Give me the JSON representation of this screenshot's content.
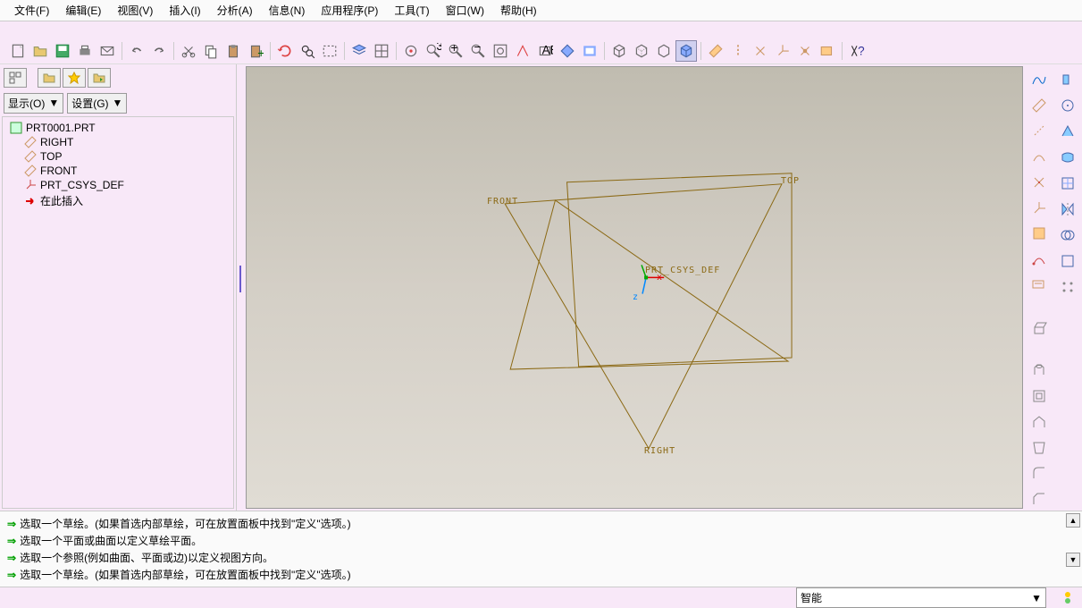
{
  "menubar": {
    "items": [
      "文件(F)",
      "编辑(E)",
      "视图(V)",
      "插入(I)",
      "分析(A)",
      "信息(N)",
      "应用程序(P)",
      "工具(T)",
      "窗口(W)",
      "帮助(H)"
    ]
  },
  "panel": {
    "show_label": "显示(O)",
    "settings_label": "设置(G)"
  },
  "tree": {
    "root": "PRT0001.PRT",
    "items": [
      {
        "label": "RIGHT",
        "type": "plane"
      },
      {
        "label": "TOP",
        "type": "plane"
      },
      {
        "label": "FRONT",
        "type": "plane"
      },
      {
        "label": "PRT_CSYS_DEF",
        "type": "csys"
      },
      {
        "label": "在此插入",
        "type": "insert"
      }
    ]
  },
  "viewport": {
    "top_label": "TOP",
    "front_label": "FRONT",
    "right_label": "RIGHT",
    "csys_label": "PRT_CSYS_DEF",
    "x_label": "x",
    "z_label": "z"
  },
  "messages": [
    "选取一个草绘。(如果首选内部草绘，可在放置面板中找到\"定义\"选项。)",
    "选取一个平面或曲面以定义草绘平面。",
    "选取一个参照(例如曲面、平面或边)以定义视图方向。",
    "选取一个草绘。(如果首选内部草绘，可在放置面板中找到\"定义\"选项。)"
  ],
  "statusbar": {
    "filter": "智能"
  },
  "chart_data": null
}
